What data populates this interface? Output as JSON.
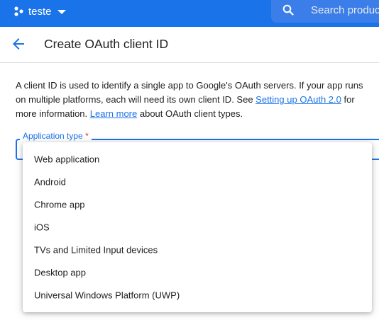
{
  "topbar": {
    "project_name": "teste",
    "search_placeholder": "Search products"
  },
  "header": {
    "title": "Create OAuth client ID"
  },
  "description": {
    "text1": "A client ID is used to identify a single app to Google's OAuth servers. If your app runs on multiple platforms, each will need its own client ID. See ",
    "link1": "Setting up OAuth 2.0",
    "text2": " for more information. ",
    "link2": "Learn more",
    "text3": " about OAuth client types."
  },
  "field": {
    "label": "Application type",
    "required_mark": "*"
  },
  "menu": {
    "items": [
      "Web application",
      "Android",
      "Chrome app",
      "iOS",
      "TVs and Limited Input devices",
      "Desktop app",
      "Universal Windows Platform (UWP)"
    ]
  },
  "colors": {
    "brand_blue": "#1a73e8",
    "required_red": "#d93025"
  }
}
